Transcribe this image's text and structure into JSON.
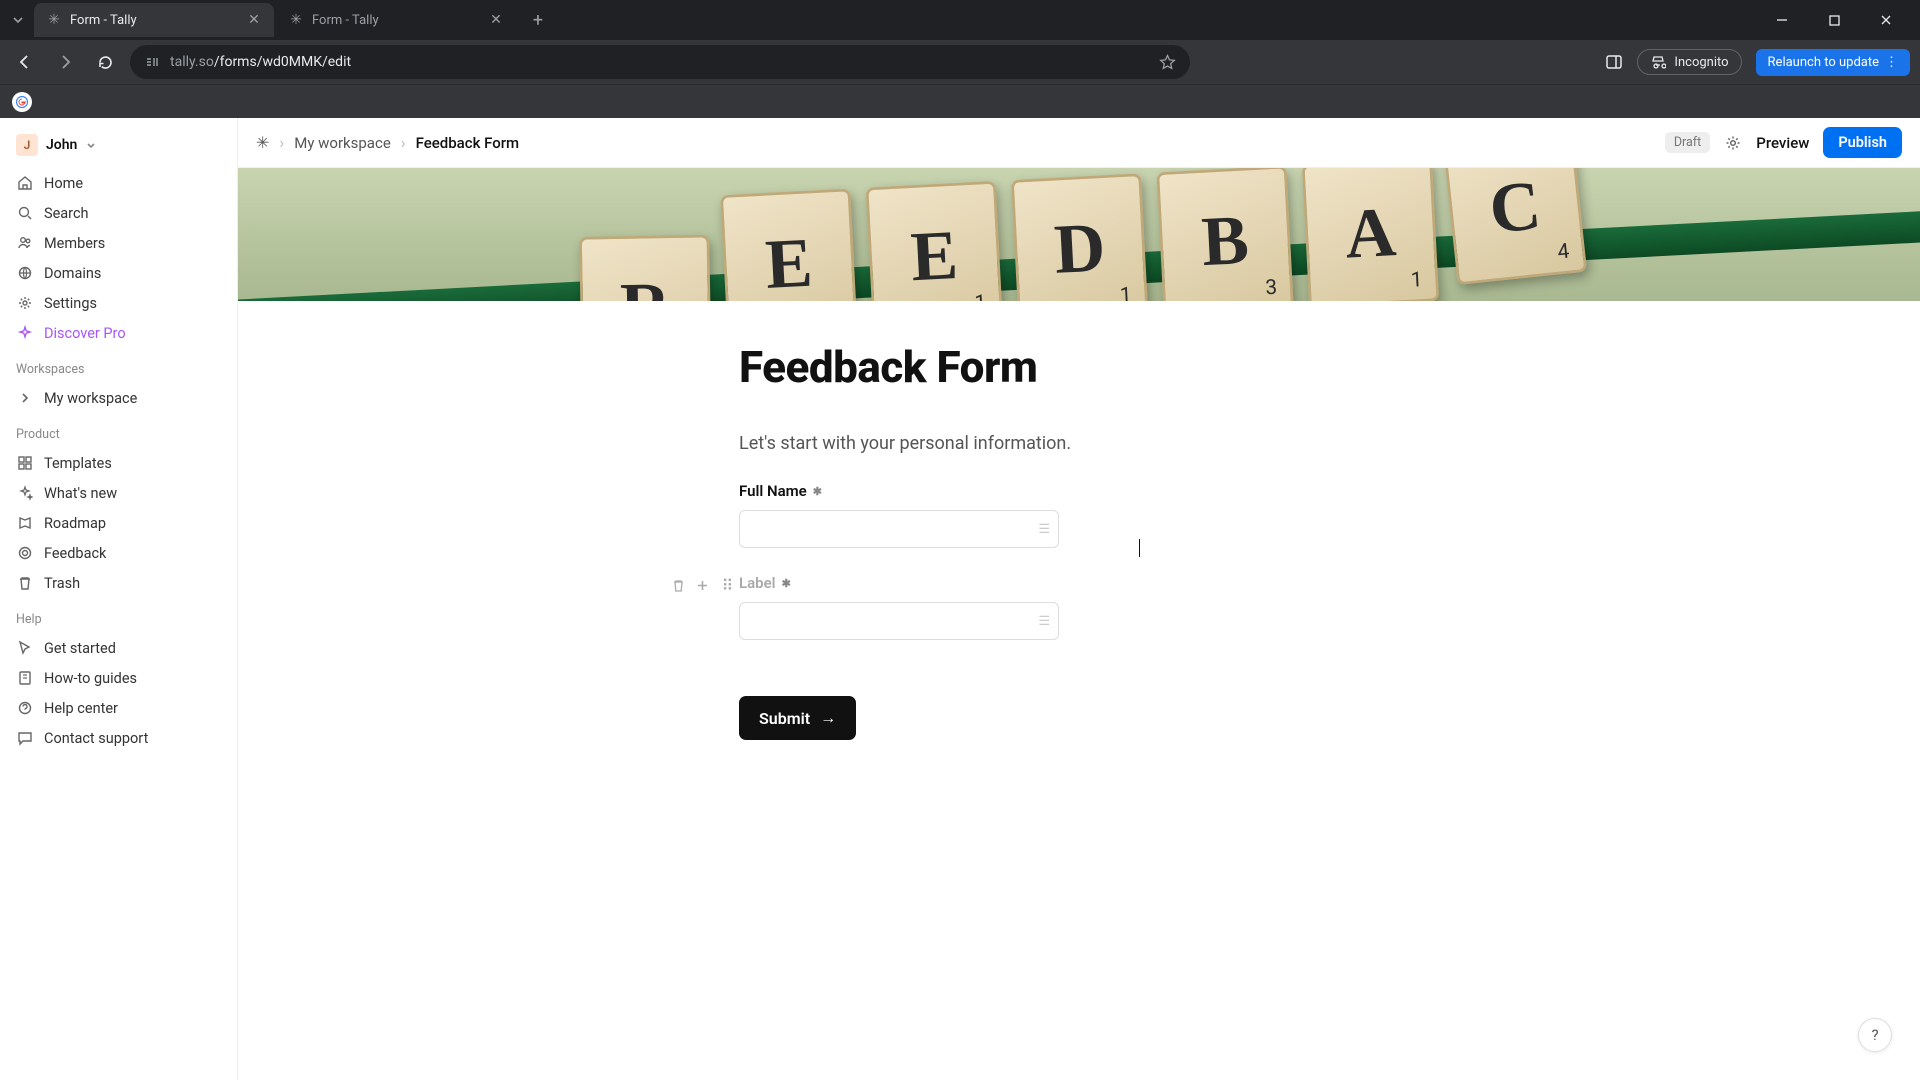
{
  "browser": {
    "tabs": [
      {
        "title": "Form - Tally",
        "active": true
      },
      {
        "title": "Form - Tally",
        "active": false
      }
    ],
    "url_host": "tally.so",
    "url_path": "/forms/wd0MMK/edit",
    "incognito_label": "Incognito",
    "relaunch_label": "Relaunch to update"
  },
  "sidebar": {
    "user_initial": "J",
    "user_name": "John",
    "nav": [
      {
        "label": "Home",
        "icon": "home"
      },
      {
        "label": "Search",
        "icon": "search"
      },
      {
        "label": "Members",
        "icon": "members"
      },
      {
        "label": "Domains",
        "icon": "domains"
      },
      {
        "label": "Settings",
        "icon": "settings"
      },
      {
        "label": "Discover Pro",
        "icon": "sparkle",
        "pro": true
      }
    ],
    "sections": {
      "workspaces_label": "Workspaces",
      "workspaces": [
        {
          "label": "My workspace"
        }
      ],
      "product_label": "Product",
      "product": [
        {
          "label": "Templates",
          "icon": "templates"
        },
        {
          "label": "What's new",
          "icon": "whatsnew"
        },
        {
          "label": "Roadmap",
          "icon": "roadmap"
        },
        {
          "label": "Feedback",
          "icon": "feedback"
        },
        {
          "label": "Trash",
          "icon": "trash"
        }
      ],
      "help_label": "Help",
      "help": [
        {
          "label": "Get started",
          "icon": "getstarted"
        },
        {
          "label": "How-to guides",
          "icon": "guides"
        },
        {
          "label": "Help center",
          "icon": "helpcenter"
        },
        {
          "label": "Contact support",
          "icon": "support"
        }
      ]
    }
  },
  "topbar": {
    "breadcrumb": [
      "My workspace",
      "Feedback Form"
    ],
    "draft_label": "Draft",
    "preview_label": "Preview",
    "publish_label": "Publish"
  },
  "cover_tiles": [
    "R",
    "E",
    "E",
    "D",
    "B",
    "A",
    "C"
  ],
  "form": {
    "title": "Feedback Form",
    "description": "Let's start with your personal information.",
    "fields": [
      {
        "label": "Full Name",
        "required": true
      },
      {
        "label": "Label",
        "required": true,
        "placeholder": true
      }
    ],
    "submit_label": "Submit"
  },
  "help_fab": "?"
}
